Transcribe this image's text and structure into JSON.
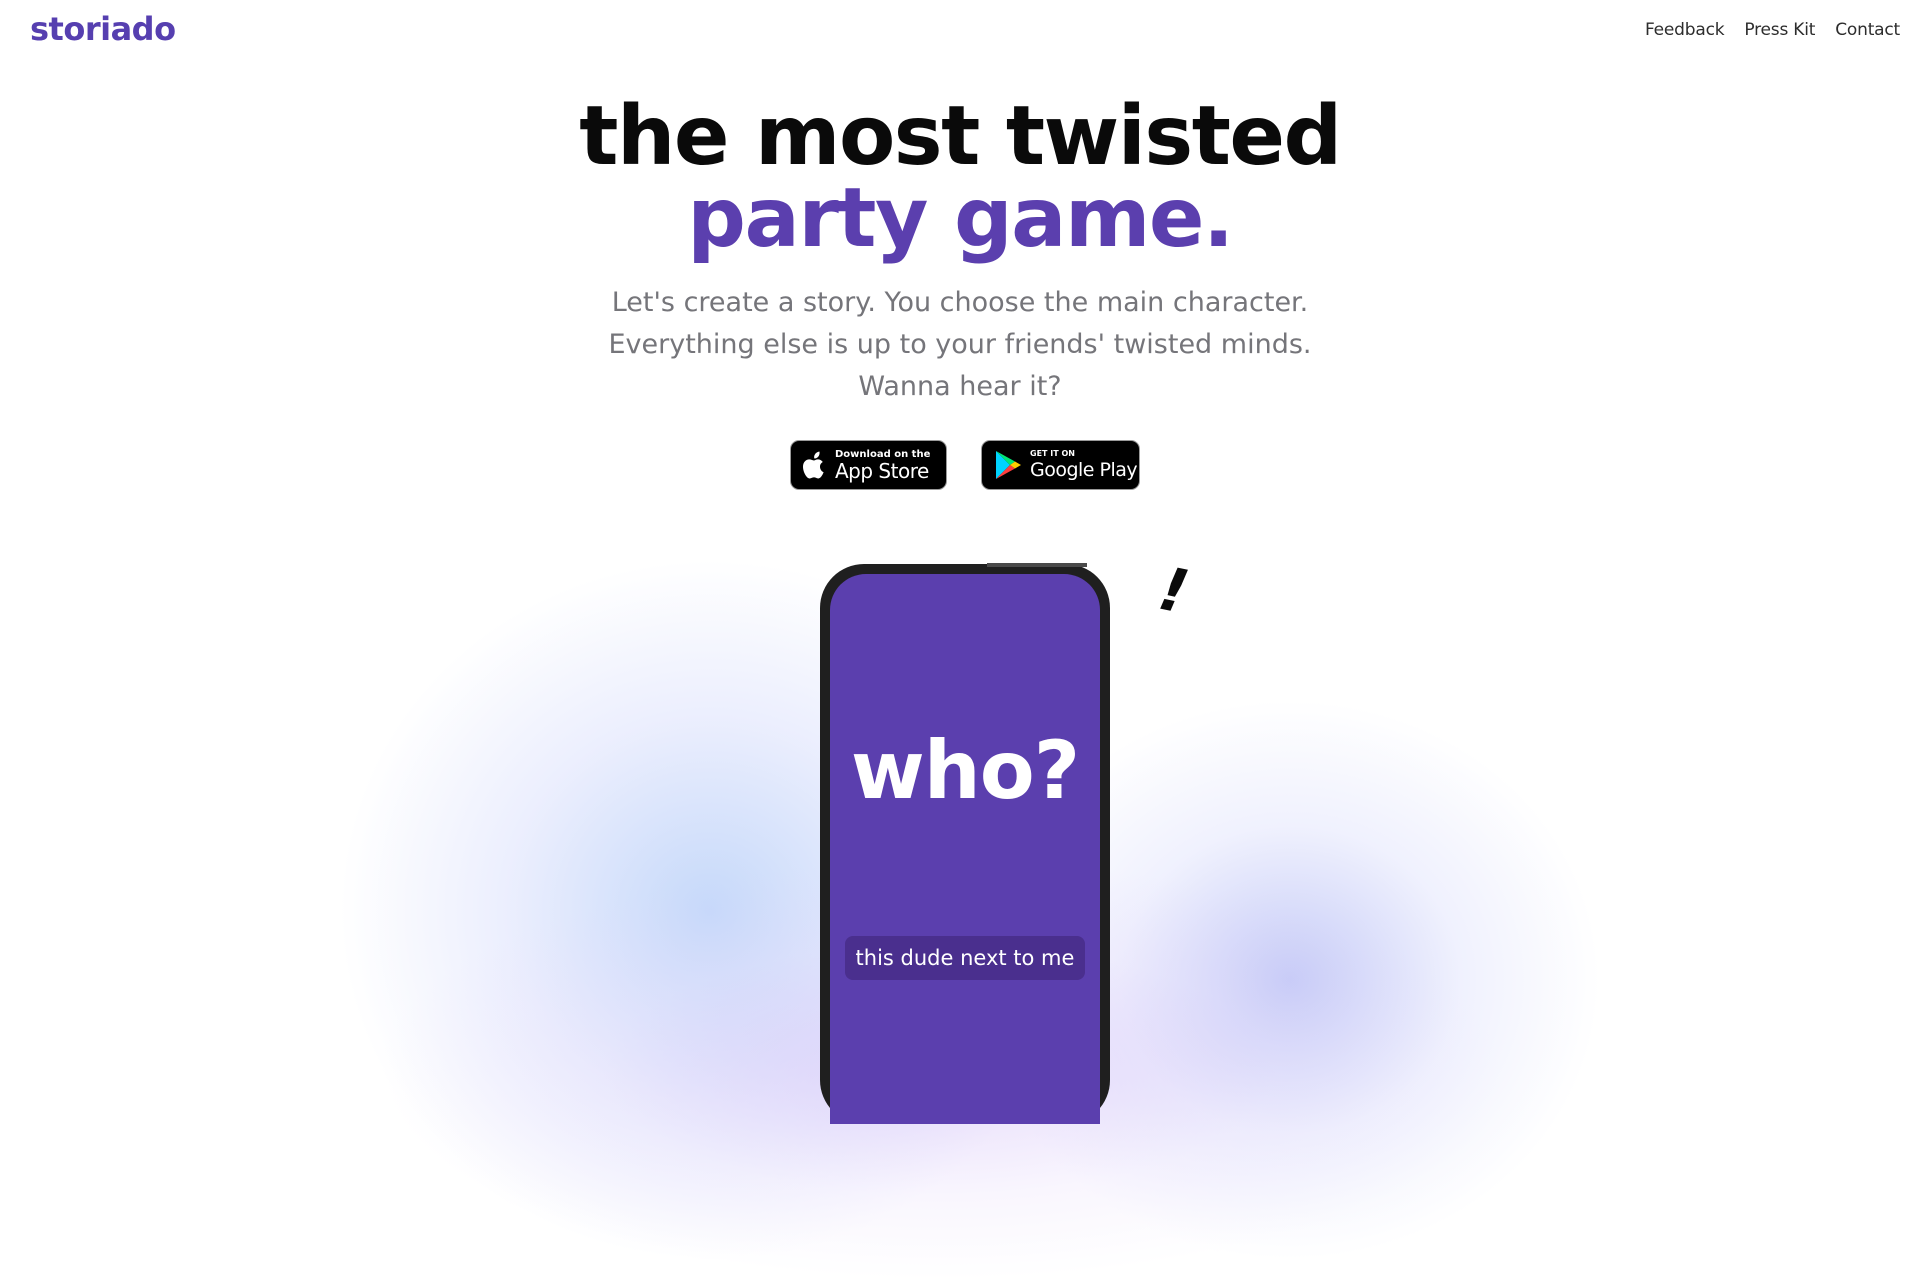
{
  "brand": {
    "name": "storiado",
    "color": "#563fb0"
  },
  "nav": {
    "links": [
      "Feedback",
      "Press Kit",
      "Contact"
    ]
  },
  "hero": {
    "title_line1": "the most twisted",
    "title_line2": "party game.",
    "subtitle_lines": [
      "Let's create a story. You choose the main character.",
      "Everything else is up to your friends' twisted minds.",
      "Wanna hear it?"
    ]
  },
  "stores": {
    "app_store": {
      "small": "Download on the",
      "big": "App Store",
      "icon": "apple-icon"
    },
    "google_play": {
      "small": "GET IT ON",
      "big": "Google Play",
      "icon": "google-play-icon"
    }
  },
  "decor": {
    "exclamation": "!"
  },
  "phone": {
    "question": "who?",
    "answer": "this dude next to me",
    "screen_color": "#5b3fae"
  },
  "colors": {
    "accent": "#5b3fae",
    "title": "#0a0a0a",
    "subtitle": "#75757a"
  }
}
